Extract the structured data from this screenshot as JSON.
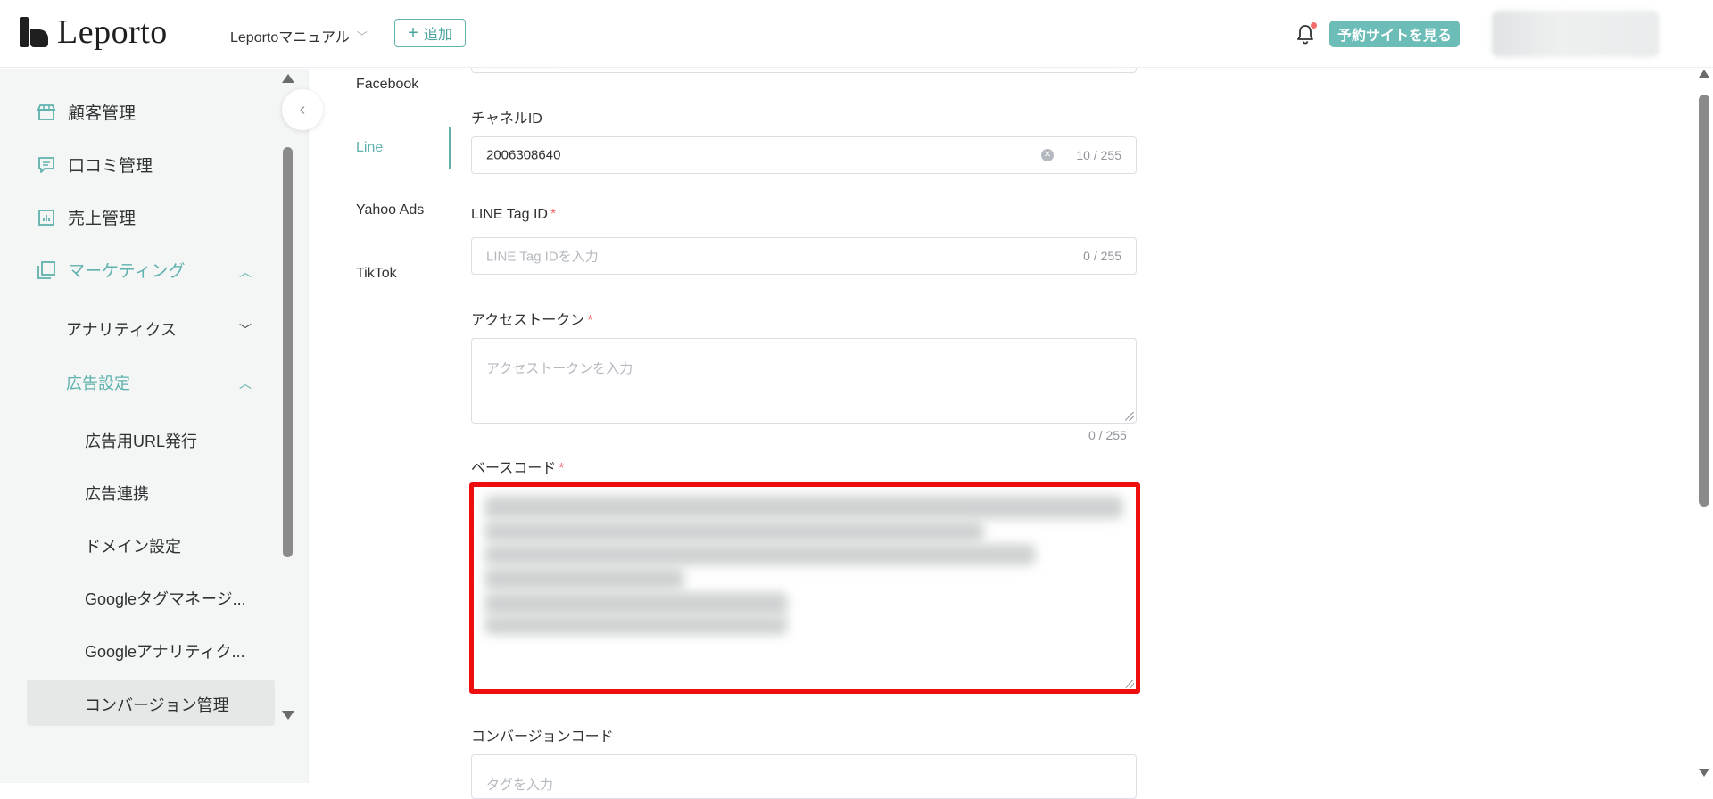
{
  "header": {
    "logo_text": "Leporto",
    "store_name": "Leportoマニュアル",
    "add_label": "追加",
    "view_site_label": "予約サイトを見る"
  },
  "sidebar": {
    "items": [
      {
        "label": "顧客管理",
        "icon": "store-icon"
      },
      {
        "label": "口コミ管理",
        "icon": "comment-icon"
      },
      {
        "label": "売上管理",
        "icon": "chart-icon"
      },
      {
        "label": "マーケティング",
        "icon": "layers-icon"
      }
    ],
    "sub_items": [
      {
        "label": "アナリティクス"
      },
      {
        "label": "広告設定"
      }
    ],
    "ad_items": [
      {
        "label": "広告用URL発行"
      },
      {
        "label": "広告連携"
      },
      {
        "label": "ドメイン設定"
      },
      {
        "label": "Googleタグマネージ..."
      },
      {
        "label": "Googleアナリティク..."
      },
      {
        "label": "コンバージョン管理"
      }
    ]
  },
  "tabs": [
    {
      "label": "Facebook"
    },
    {
      "label": "Line"
    },
    {
      "label": "Yahoo Ads"
    },
    {
      "label": "TikTok"
    }
  ],
  "form": {
    "channel_id": {
      "label": "チャネルID",
      "value": "2006308640",
      "count": "10 / 255"
    },
    "line_tag_id": {
      "label": "LINE Tag ID",
      "required": "*",
      "placeholder": "LINE Tag IDを入力",
      "count": "0 / 255"
    },
    "access_token": {
      "label": "アクセストークン",
      "required": "*",
      "placeholder": "アクセストークンを入力",
      "count": "0 / 255"
    },
    "base_code": {
      "label": "ベースコード",
      "required": "*"
    },
    "conversion_code": {
      "label": "コンバージョンコード",
      "placeholder": "タグを入力"
    }
  },
  "colors": {
    "accent": "#5fb2ad",
    "highlight": "#ef0e0e",
    "required": "#f56c6c"
  }
}
